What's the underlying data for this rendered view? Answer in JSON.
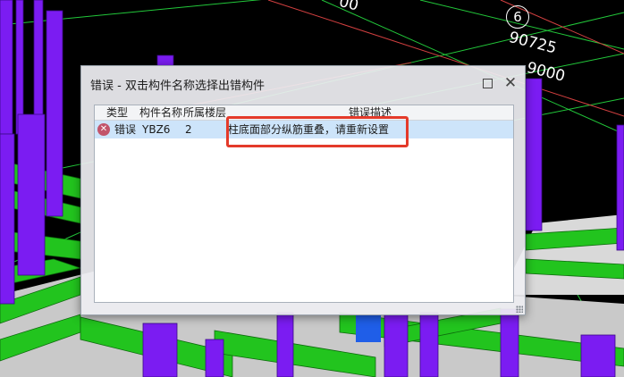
{
  "background": {
    "axis_label_1": "90725",
    "axis_label_2": "9000",
    "axis_label_top": "00",
    "grid_bubble": "6"
  },
  "dialog": {
    "title": "错误 - 双击构件名称选择出错构件",
    "columns": {
      "type": "类型",
      "name": "构件名称",
      "floor": "所属楼层",
      "desc": "错误描述"
    },
    "rows": [
      {
        "type": "错误",
        "name": "YBZ6",
        "floor": "2",
        "desc": "柱底面部分纵筋重叠，请重新设置"
      }
    ]
  },
  "colors": {
    "column_purple": "#7b1cf2",
    "beam_green": "#22c41e",
    "axis_green": "#1fc83a",
    "highlight_red": "#e43a2a",
    "row_select": "#cde4fa"
  }
}
